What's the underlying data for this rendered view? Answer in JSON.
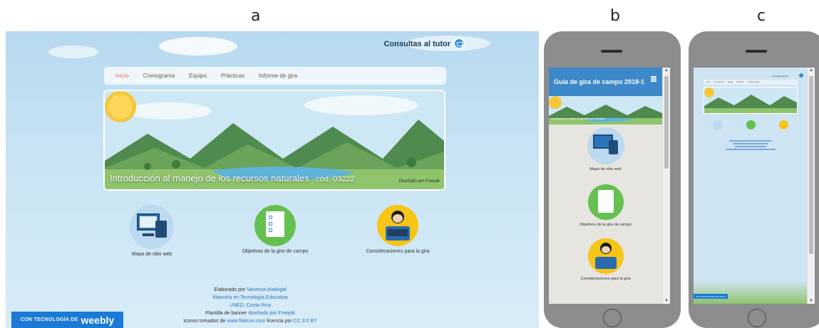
{
  "panels": {
    "a": "a",
    "b": "b",
    "c": "c"
  },
  "desktop": {
    "tutor_link": "Consultas al tutor",
    "nav": [
      "Inicio",
      "Cronograma",
      "Equipo",
      "Prácticas",
      "Informe de gira"
    ],
    "banner_title": "Introducción al manejo de los recursos naturales",
    "banner_code": "cód. 03222",
    "banner_credit": "Diseñado por Freepik",
    "cards": [
      "Mapa de sitio web",
      "Objetivos de la gira de campo",
      "Consideraciones para la gira"
    ],
    "footer": {
      "elaborado_prefix": "Elaborado por ",
      "author": "Vanessa Madrigal",
      "program": "Maestría en Tecnología Educativa",
      "institution": "UNED, Costa Rica",
      "template_prefix": "Plantilla de banner ",
      "template_link": "diseñado por Freepik",
      "icons_prefix": "Iconos tomados de ",
      "icons_site": "www.flaticon.com",
      "license_prefix": " licencia por ",
      "license": "CC 3.0 BY"
    },
    "weebly_prefix": "CON TECNOLOGÍA DE",
    "weebly_brand": "weebly"
  },
  "phone_b": {
    "title": "Guía de gira de campo 2018-1",
    "banner_caption": "Introducción al manejo de los recursos naturales",
    "cards": [
      "Mapa de sitio web",
      "Objetivos de la gira de campo",
      "Consideraciones para la gira"
    ]
  },
  "phone_c": {
    "tutor": "Consultas al tutor",
    "nav": [
      "Inicio",
      "Cronograma",
      "Equipo",
      "Prácticas",
      "Informe de gira"
    ],
    "weebly": "CON TECNOLOGÍA DE weebly"
  },
  "colors": {
    "sky": "#c9e4f4",
    "accent_blue": "#1a7ad6",
    "header_blue": "#3d88c9",
    "nav_active": "#e97a4b",
    "phone_body": "#8b8c8e"
  }
}
